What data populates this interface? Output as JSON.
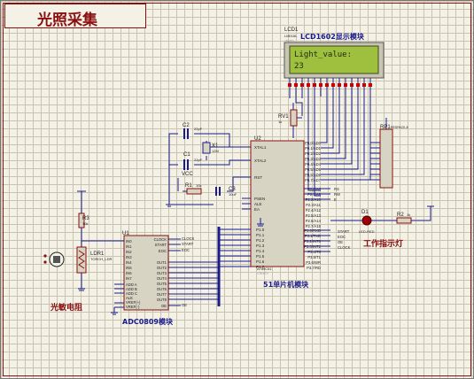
{
  "title": "光照采集",
  "lcd": {
    "ref": "LCD1",
    "part": "LM016L",
    "caption": "LCD1602显示模块",
    "line1": "Light_value:",
    "line2": "23",
    "text_hidden": "<TEXT>"
  },
  "mcu": {
    "ref": "U2",
    "part": "AT89C51",
    "text": "<TEXT>",
    "caption": "51单片机模块",
    "left_pins": [
      "XTAL1",
      "XTAL2",
      "RST",
      "PSEN",
      "ALE",
      "EA"
    ],
    "right_pins_top": [
      "P0.0/AD0",
      "P0.1/AD1",
      "P0.2/AD2",
      "P0.3/AD3",
      "P0.4/AD4",
      "P0.5/AD5",
      "P0.6/AD6",
      "P0.7/AD7"
    ],
    "right_pins_mid": [
      "P2.0/A8",
      "P2.1/A9",
      "P2.2/A10",
      "P2.3/A11",
      "P2.4/A12",
      "P2.5/A13",
      "P2.6/A14",
      "P2.7/A15"
    ],
    "right_pins_bot": [
      "P3.0/RXD",
      "P3.1/TXD",
      "P3.2/INT0",
      "P3.3/INT1",
      "P3.4/T0",
      "P3.5/T1",
      "P3.6/WR",
      "P3.7/RD"
    ],
    "p1_pins": [
      "P1.0",
      "P1.1",
      "P1.2",
      "P1.3",
      "P1.4",
      "P1.5",
      "P1.6",
      "P1.7"
    ]
  },
  "adc": {
    "ref": "U1",
    "part": "ADC0809",
    "caption": "ADC0809模块",
    "left_pins": [
      "IN0",
      "IN1",
      "IN2",
      "IN3",
      "IN4",
      "IN5",
      "IN6",
      "IN7",
      "ADD A",
      "ADD B",
      "ADD C",
      "ALE",
      "VREF(+)",
      "VREF(-)"
    ],
    "right_pins": [
      "CLOCK",
      "START",
      "EOC",
      "OUT1",
      "OUT2",
      "OUT3",
      "OUT4",
      "OUT5",
      "OUT6",
      "OUT7",
      "OUT8",
      "OE"
    ],
    "net_labels": [
      "CLOCK",
      "START",
      "EOC",
      "OE"
    ]
  },
  "ldr": {
    "ref": "LDR1",
    "part": "TORCH_LDR",
    "caption": "光敏电阻"
  },
  "r3": {
    "ref": "R3",
    "value": "10k"
  },
  "r2": {
    "ref": "R2",
    "value": "1k"
  },
  "rv1": {
    "ref": "RV1",
    "value": "1k"
  },
  "rp1": {
    "ref": "RP1",
    "part": "RESPACK-8"
  },
  "d1": {
    "ref": "D1",
    "part": "LED-RED",
    "caption": "工作指示灯"
  },
  "c1": {
    "ref": "C1",
    "value": "22pF"
  },
  "c2": {
    "ref": "C2",
    "value": "22pF"
  },
  "c3": {
    "ref": "C3",
    "value": "10uF"
  },
  "r1": {
    "ref": "R1",
    "value": "10k"
  },
  "x1": {
    "ref": "X1",
    "value": "12M"
  },
  "vcc": "VCC",
  "mcu_p3_nets": [
    "START",
    "EOC",
    "OE",
    "CLOCK"
  ],
  "mcu_p2_nets": [
    "RS",
    "RW",
    "E"
  ],
  "text_tag": "<TEXT>",
  "colors": {
    "wire": "#1a1a8c",
    "part_fill": "#d8d4c4",
    "part_stroke": "#8a1010",
    "pin": "#cc0000",
    "lcd_bg": "#9fbf3f",
    "lcd_text": "#1a2a10"
  }
}
